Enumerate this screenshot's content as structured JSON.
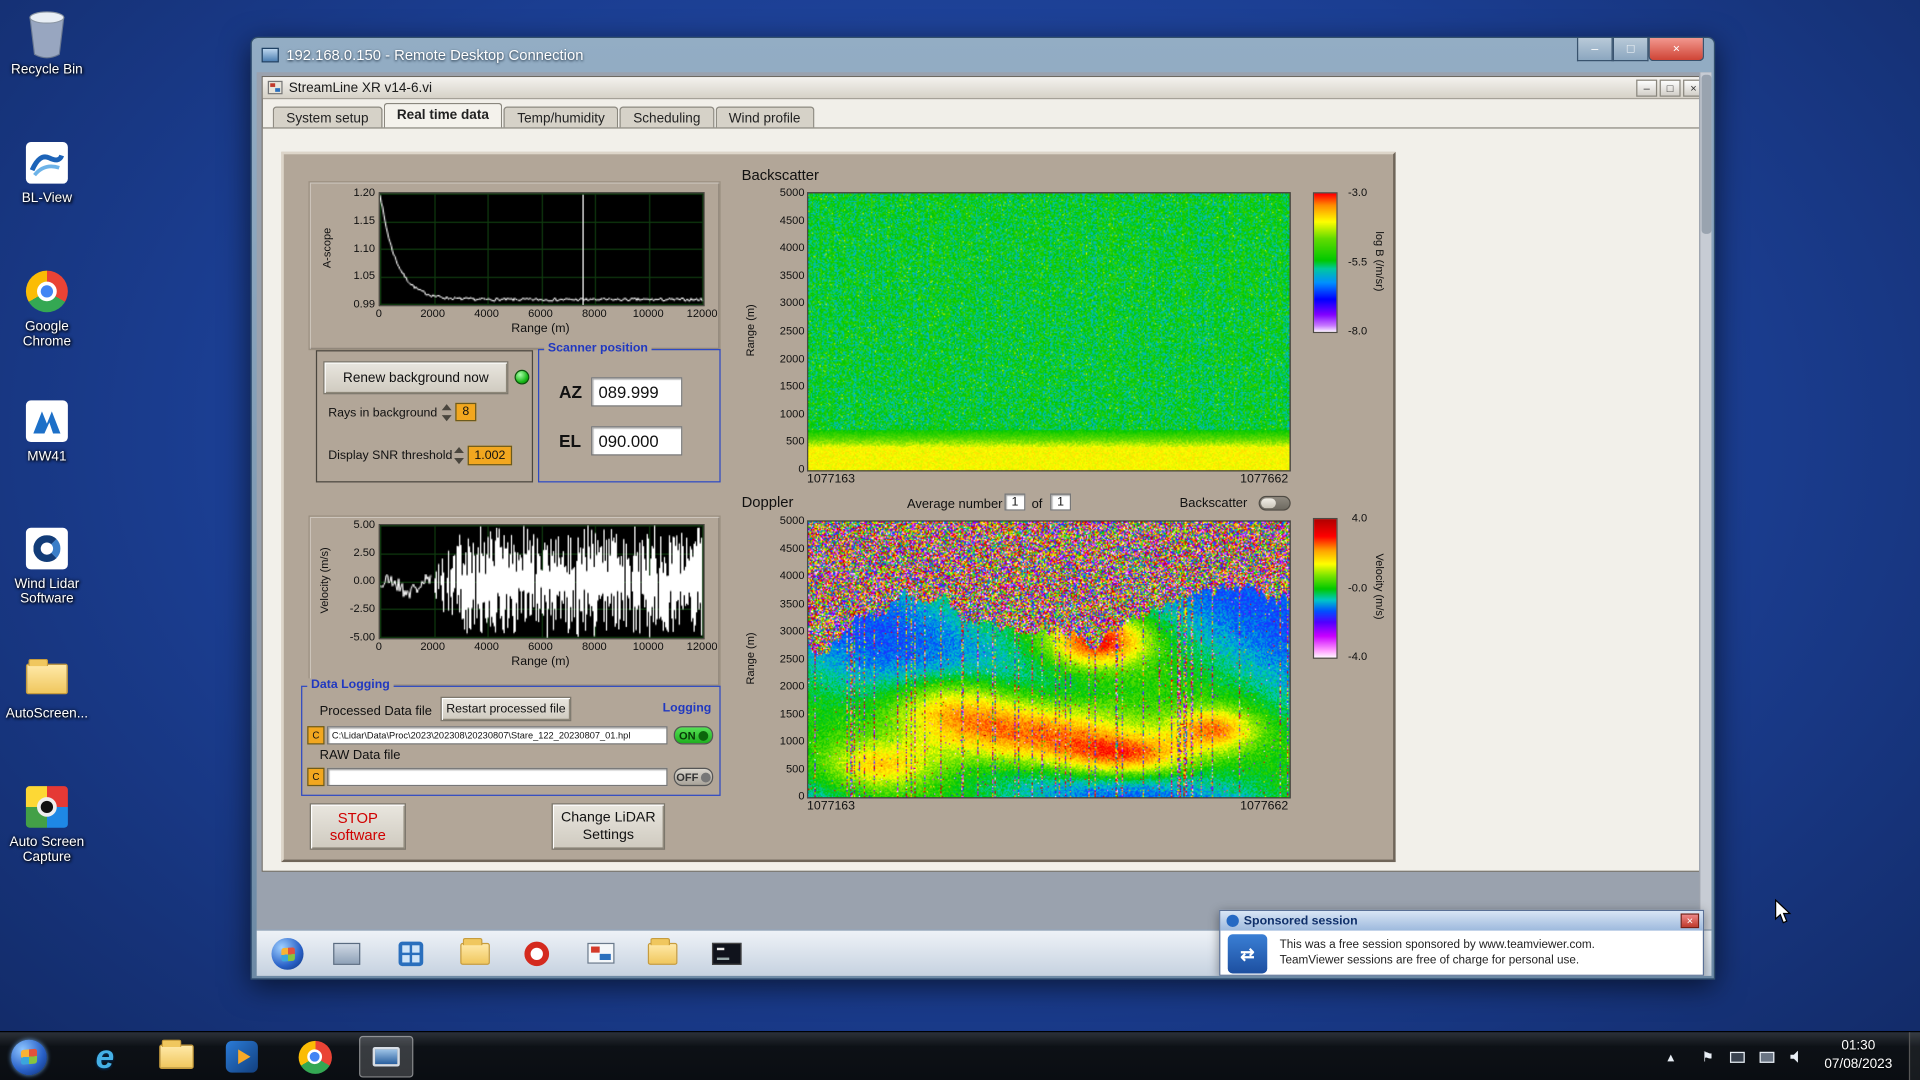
{
  "colors": {
    "desktop_bg": "#1b3e92",
    "panel_bg": "#b2a698",
    "group_label_blue": "#2038c0",
    "value_amber": "#f2a71f",
    "led_green": "#28c828",
    "logging_on_green": "#2fd42f"
  },
  "desktop": {
    "icons": [
      {
        "label": "Recycle Bin"
      },
      {
        "label": "BL-View"
      },
      {
        "label": "Google Chrome"
      },
      {
        "label": "MW41"
      },
      {
        "label": "Wind Lidar Software"
      },
      {
        "label": "AutoScreen..."
      },
      {
        "label": "Auto Screen Capture"
      }
    ]
  },
  "rdp_window": {
    "title": "192.168.0.150 - Remote Desktop Connection"
  },
  "app_window": {
    "title": "StreamLine XR v14-6.vi",
    "tabs": [
      {
        "label": "System setup"
      },
      {
        "label": "Real time data"
      },
      {
        "label": "Temp/humidity"
      },
      {
        "label": "Scheduling"
      },
      {
        "label": "Wind profile"
      }
    ],
    "active_tab": "Real time data"
  },
  "controls": {
    "renew_background_button": "Renew background now",
    "rays_in_background_label": "Rays in background",
    "rays_in_background_value": "8",
    "snr_threshold_label": "Display SNR threshold",
    "snr_threshold_value": "1.002",
    "scanner_position": {
      "title": "Scanner position",
      "az_label": "AZ",
      "az_value": "089.999",
      "el_label": "EL",
      "el_value": "090.000"
    },
    "backscatter_section_label": "Backscatter",
    "doppler_header": {
      "section_label": "Doppler",
      "average_number_label": "Average number",
      "average_value": "1",
      "of_label": "of",
      "total_value": "1",
      "backscatter_toggle_label": "Backscatter"
    },
    "data_logging": {
      "title": "Data Logging",
      "processed_label": "Processed Data file",
      "restart_button": "Restart processed file",
      "logging_label": "Logging",
      "drive_badge": "C",
      "processed_path": "C:\\Lidar\\Data\\Proc\\2023\\202308\\20230807\\Stare_122_20230807_01.hpl",
      "on_label": "ON",
      "raw_label": "RAW Data file",
      "raw_path": "",
      "off_label": "OFF"
    },
    "stop_button": {
      "line1": "STOP",
      "line2": "software"
    },
    "change_settings_button": {
      "line1": "Change LiDAR",
      "line2": "Settings"
    }
  },
  "chart_data": [
    {
      "id": "ascope",
      "type": "line",
      "ylabel": "A-scope",
      "xlabel": "Range (m)",
      "xlim": [
        0,
        12000
      ],
      "ylim": [
        0.99,
        1.2
      ],
      "xticks": [
        "0",
        "2000",
        "4000",
        "6000",
        "8000",
        "10000",
        "12000"
      ],
      "yticks": [
        "1.20",
        "1.15",
        "1.10",
        "1.05",
        "0.99"
      ],
      "line_color": "#ffffff",
      "plot_bg": "#000000",
      "profile": {
        "start_value": 1.2,
        "baseline": 1.0,
        "decay_const_m": 600,
        "noise": 0.006,
        "cursor_x_m": 7500
      }
    },
    {
      "id": "backscatter",
      "type": "heatmap",
      "section": "Backscatter",
      "ylabel": "Range (m)",
      "yticks": [
        "5000",
        "4500",
        "4000",
        "3500",
        "3000",
        "2500",
        "2000",
        "1500",
        "1000",
        "500",
        "0"
      ],
      "xticks": [
        "1077163",
        "1077662"
      ],
      "ylim_m": [
        0,
        5000
      ],
      "colorbar": {
        "label": "log B (/m/sr)",
        "ticks": [
          "-3.0",
          "-5.5",
          "-8.0"
        ],
        "min": -8,
        "max": -3,
        "stops": [
          [
            0,
            "#ffffff"
          ],
          [
            0.05,
            "#c878ff"
          ],
          [
            0.13,
            "#8000ff"
          ],
          [
            0.24,
            "#0000ff"
          ],
          [
            0.36,
            "#0090ff"
          ],
          [
            0.46,
            "#00c8a0"
          ],
          [
            0.52,
            "#00c800"
          ],
          [
            0.68,
            "#64dc00"
          ],
          [
            0.8,
            "#ffff00"
          ],
          [
            0.92,
            "#ff8c00"
          ],
          [
            1,
            "#ff0000"
          ]
        ]
      },
      "field": {
        "mean_log_b": -5.45,
        "speckle": 0.8,
        "surface_band_top_m": 430,
        "surface_band_log_b": -4.0
      }
    },
    {
      "id": "velocity",
      "type": "line",
      "ylabel": "Velocity (m/s)",
      "xlabel": "Range (m)",
      "xlim": [
        0,
        12000
      ],
      "ylim": [
        -5,
        5
      ],
      "xticks": [
        "0",
        "2000",
        "4000",
        "6000",
        "8000",
        "10000",
        "12000"
      ],
      "yticks": [
        "5.00",
        "2.50",
        "0.00",
        "-2.50",
        "-5.00"
      ],
      "line_color": "#ffffff",
      "plot_bg": "#000000",
      "profile": {
        "coherent_to_m": 1900,
        "coherent_mean": -0.4,
        "coherent_noise": 1.4,
        "aliased_beyond": true
      }
    },
    {
      "id": "doppler",
      "type": "heatmap",
      "section": "Doppler",
      "ylabel": "Range (m)",
      "yticks": [
        "5000",
        "4500",
        "4000",
        "3500",
        "3000",
        "2500",
        "2000",
        "1500",
        "1000",
        "500",
        "0"
      ],
      "xticks": [
        "1077163",
        "1077662"
      ],
      "ylim_m": [
        0,
        5000
      ],
      "colorbar": {
        "label": "Velocity (m/s)",
        "ticks": [
          "4.0",
          "-0.0",
          "-4.0"
        ],
        "min": -4,
        "max": 4,
        "stops": [
          [
            0,
            "#ffffff"
          ],
          [
            0.06,
            "#ff96ff"
          ],
          [
            0.16,
            "#c800ff"
          ],
          [
            0.26,
            "#5000ff"
          ],
          [
            0.34,
            "#0050ff"
          ],
          [
            0.42,
            "#00c8c8"
          ],
          [
            0.5,
            "#00c800"
          ],
          [
            0.6,
            "#80e600"
          ],
          [
            0.68,
            "#ffff00"
          ],
          [
            0.78,
            "#ffa000"
          ],
          [
            0.88,
            "#ff0000"
          ],
          [
            1,
            "#b40000"
          ]
        ]
      },
      "field": {
        "signal_top_m_mean": 2800,
        "background_velocity": -0.6,
        "updraft_blob_max": 3.4,
        "noise_above_signal": true
      }
    }
  ],
  "teamviewer_popup": {
    "title": "Sponsored session",
    "line1": "This was a free session sponsored by www.teamviewer.com.",
    "line2": "TeamViewer sessions are free of charge for personal use."
  },
  "taskbar": {
    "clock_time": "01:30",
    "clock_date": "07/08/2023"
  }
}
